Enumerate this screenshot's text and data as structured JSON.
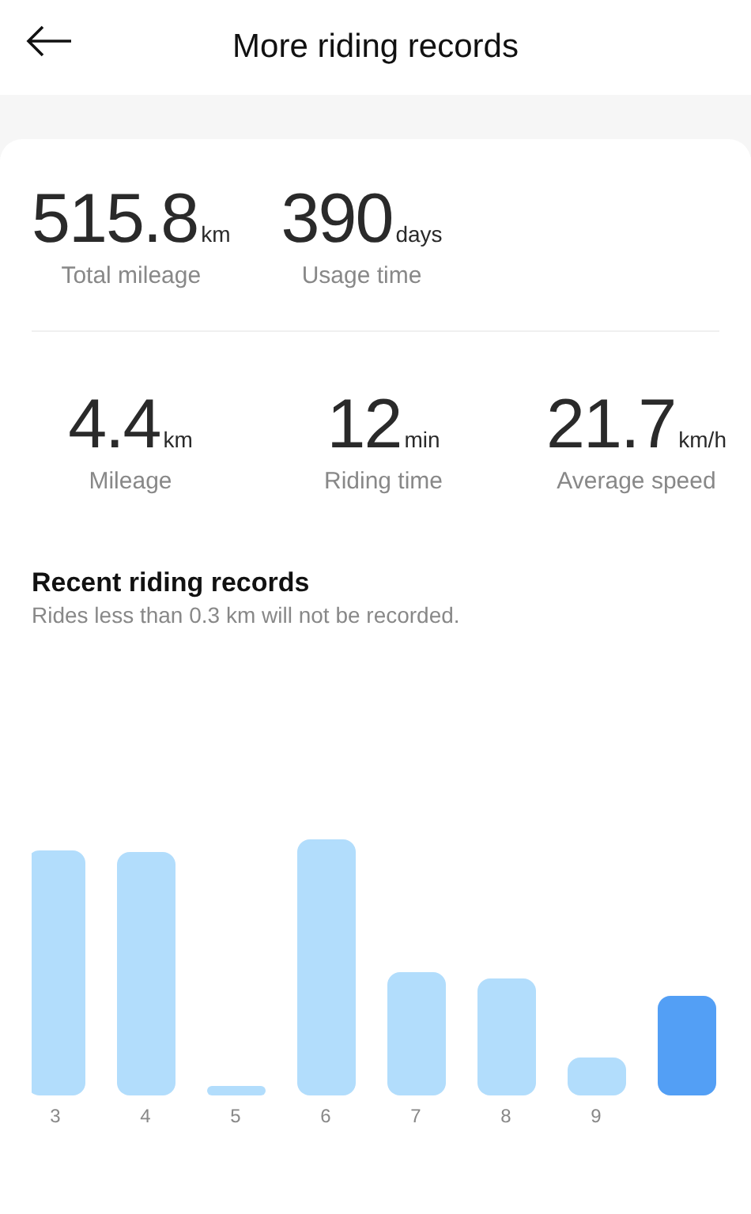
{
  "header": {
    "title": "More riding records"
  },
  "totals": [
    {
      "value": "515.8",
      "unit": "km",
      "label": "Total mileage"
    },
    {
      "value": "390",
      "unit": "days",
      "label": "Usage time"
    }
  ],
  "latest": [
    {
      "value": "4.4",
      "unit": "km",
      "label": "Mileage"
    },
    {
      "value": "12",
      "unit": "min",
      "label": "Riding time"
    },
    {
      "value": "21.7",
      "unit": "km/h",
      "label": "Average speed"
    }
  ],
  "recent": {
    "title": "Recent riding records",
    "note": "Rides less than 0.3 km will not be recorded.",
    "bars": [
      {
        "label": "3",
        "selected": false
      },
      {
        "label": "4",
        "selected": false
      },
      {
        "label": "5",
        "selected": false
      },
      {
        "label": "6",
        "selected": false
      },
      {
        "label": "7",
        "selected": false
      },
      {
        "label": "8",
        "selected": false
      },
      {
        "label": "9",
        "selected": false
      },
      {
        "selected": true
      }
    ]
  }
}
